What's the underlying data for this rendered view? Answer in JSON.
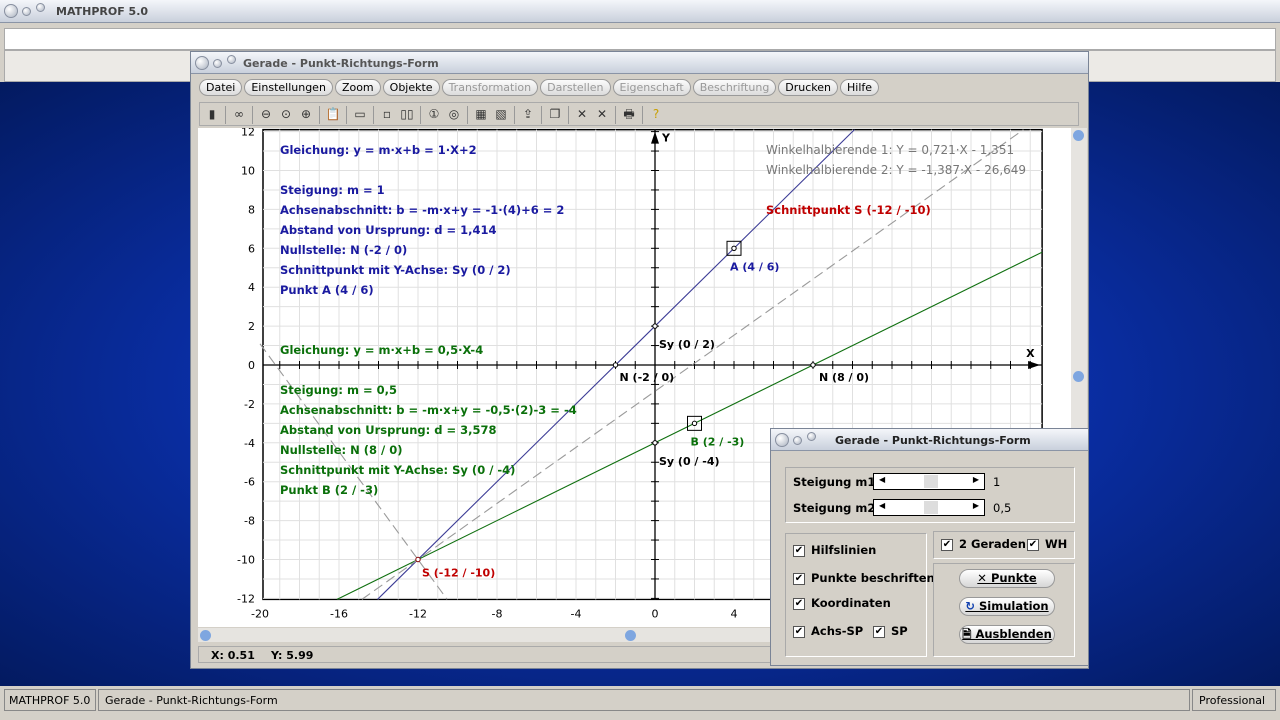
{
  "app": {
    "title": "MATHPROF 5.0"
  },
  "window": {
    "title": "Gerade - Punkt-Richtungs-Form",
    "menu": [
      {
        "label": "Datei",
        "enabled": true
      },
      {
        "label": "Einstellungen",
        "enabled": true
      },
      {
        "label": "Zoom",
        "enabled": true
      },
      {
        "label": "Objekte",
        "enabled": true
      },
      {
        "label": "Transformation",
        "enabled": false
      },
      {
        "label": "Darstellen",
        "enabled": false
      },
      {
        "label": "Eigenschaft",
        "enabled": false
      },
      {
        "label": "Beschriftung",
        "enabled": false
      },
      {
        "label": "Drucken",
        "enabled": true
      },
      {
        "label": "Hilfe",
        "enabled": true
      }
    ],
    "toolbar": [
      "window-icon",
      "glasses-icon",
      "zoom-out-icon",
      "zoom-reset-icon",
      "zoom-in-icon",
      "clipboard-icon",
      "layout-icon",
      "frame-icon",
      "frame2-icon",
      "circle1-icon",
      "circle2-icon",
      "table-icon",
      "image-icon",
      "export-icon",
      "copy-icon",
      "cross1-icon",
      "cross2-icon",
      "printer-icon",
      "help-icon"
    ],
    "status": {
      "x": "X: 0.51",
      "y": "Y: 5.99"
    }
  },
  "chart_data": {
    "type": "line",
    "xlim": [
      -20,
      19.6
    ],
    "ylim": [
      -12,
      12
    ],
    "grid": true,
    "xlabel": "X",
    "ylabel": "Y",
    "xticks": [
      -20,
      -16,
      -12,
      -8,
      -4,
      0,
      4,
      8
    ],
    "yticks": [
      12,
      10,
      8,
      6,
      4,
      2,
      0,
      -2,
      -4,
      -6,
      -8,
      -10,
      -12
    ],
    "series": [
      {
        "equation": "y = 1x + 2",
        "m": 1,
        "b": 2,
        "color": "#3c3c96",
        "style": "solid"
      },
      {
        "equation": "y = 0.5x - 4",
        "m": 0.5,
        "b": -4,
        "color": "#107010",
        "style": "solid"
      },
      {
        "equation": "Y = 0,721·X - 1,351",
        "m": 0.721,
        "b": -1.351,
        "color": "#9a9a9a",
        "style": "dashed"
      },
      {
        "equation": "Y = -1,387·X - 26,649",
        "m": -1.387,
        "b": -26.649,
        "color": "#9a9a9a",
        "style": "dashed"
      }
    ],
    "points": [
      {
        "label": "A (4 / 6)",
        "x": 4,
        "y": 6,
        "color": "#1a1aa0",
        "marker": "box"
      },
      {
        "label": "B (2 / -3)",
        "x": 2,
        "y": -3,
        "color": "#0a700a",
        "marker": "box"
      },
      {
        "label": "S (-12 / -10)",
        "x": -12,
        "y": -10,
        "color": "#c00000"
      },
      {
        "label": "N (-2 / 0)",
        "x": -2,
        "y": 0,
        "color": "#000"
      },
      {
        "label": "N (8 / 0)",
        "x": 8,
        "y": 0,
        "color": "#000"
      },
      {
        "label": "Sy (0 / 2)",
        "x": 0,
        "y": 2,
        "color": "#000"
      },
      {
        "label": "Sy (0 / -4)",
        "x": 0,
        "y": -4,
        "color": "#000"
      }
    ]
  },
  "info": {
    "line1": [
      "Gleichung: y = m·x+b = 1·X+2",
      "Steigung: m = 1",
      "Achsenabschnitt: b = -m·x+y = -1·(4)+6 = 2",
      "Abstand von Ursprung: d = 1,414",
      "Nullstelle: N (-2 / 0)",
      "Schnittpunkt mit Y-Achse: Sy (0 / 2)",
      "Punkt A (4 / 6)"
    ],
    "line2": [
      "Gleichung: y = m·x+b = 0,5·X-4",
      "Steigung: m = 0,5",
      "Achsenabschnitt: b = -m·x+y = -0,5·(2)-3 = -4",
      "Abstand von Ursprung: d = 3,578",
      "Nullstelle: N (8 / 0)",
      "Schnittpunkt mit Y-Achse: Sy (0 / -4)",
      "Punkt B (2 / -3)"
    ],
    "wh1": "Winkelhalbierende 1: Y = 0,721·X - 1,351",
    "wh2": "Winkelhalbierende 2: Y = -1,387·X - 26,649",
    "intersection": "Schnittpunkt S (-12 / -10)"
  },
  "dialog": {
    "title": "Gerade - Punkt-Richtungs-Form",
    "m1_label": "Steigung m1:",
    "m1_value": "1",
    "m2_label": "Steigung m2:",
    "m2_value": "0,5",
    "checks": {
      "hilfslinien": "Hilfslinien",
      "punkte": "Punkte beschriften",
      "koordinaten": "Koordinaten",
      "achssp": "Achs-SP",
      "sp": "SP",
      "geraden": "2 Geraden",
      "wh": "WH"
    },
    "buttons": {
      "punkte": "Punkte",
      "simulation": "Simulation",
      "ausblenden": "Ausblenden"
    }
  },
  "statusbar": {
    "app": "MATHPROF 5.0",
    "doc": "Gerade - Punkt-Richtungs-Form",
    "edition": "Professional"
  }
}
